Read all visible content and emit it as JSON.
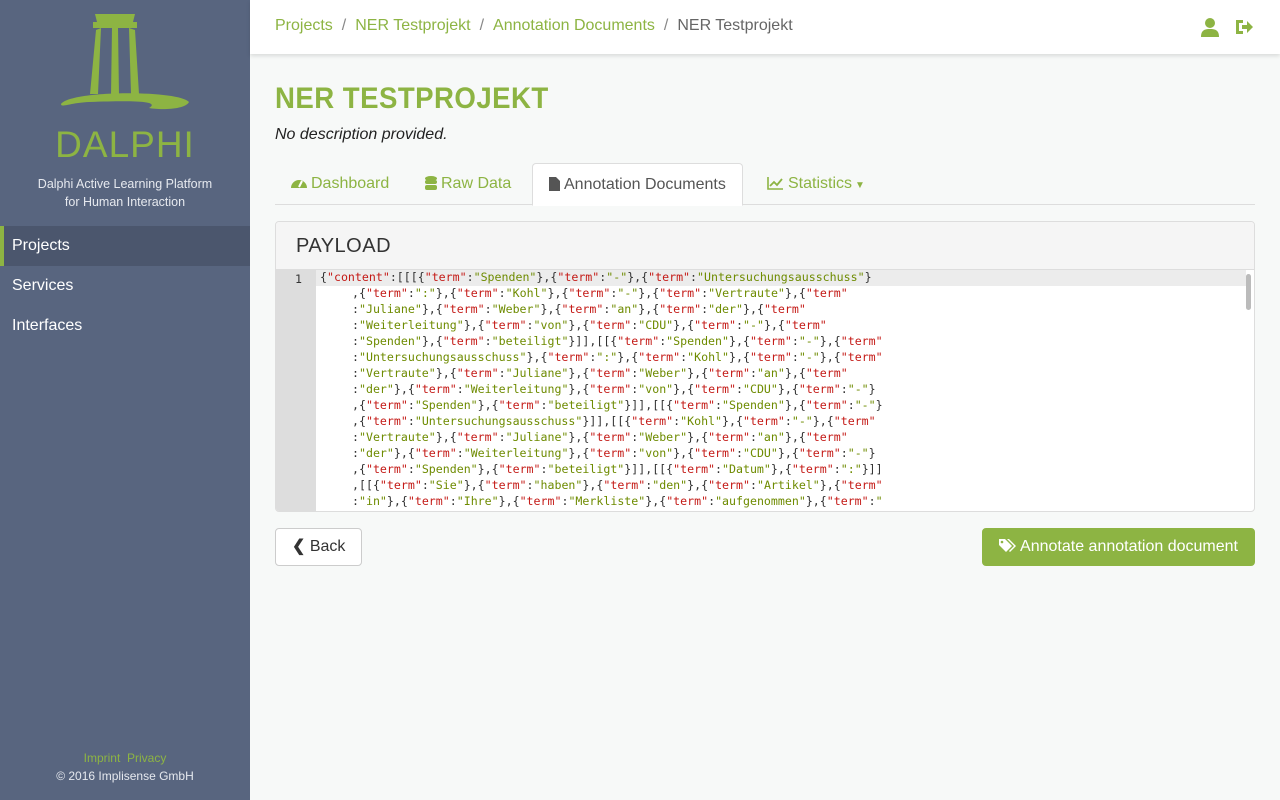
{
  "sidebar": {
    "brand": "DALPHI",
    "tagline_1": "Dalphi Active Learning Platform",
    "tagline_2": "for Human Interaction",
    "items": [
      {
        "label": "Projects",
        "active": true
      },
      {
        "label": "Services"
      },
      {
        "label": "Interfaces"
      }
    ],
    "footer": {
      "imprint": "Imprint",
      "privacy": "Privacy",
      "copyright": "© 2016 Implisense GmbH"
    }
  },
  "breadcrumb": [
    "Projects",
    "NER Testprojekt",
    "Annotation Documents",
    "NER Testprojekt"
  ],
  "header_icons": [
    "user-icon",
    "sign-out-icon"
  ],
  "page": {
    "title": "NER TESTPROJEKT",
    "description": "No description provided."
  },
  "tabs": [
    {
      "label": "Dashboard",
      "icon": "dashboard-icon"
    },
    {
      "label": "Raw Data",
      "icon": "database-icon"
    },
    {
      "label": "Annotation Documents",
      "icon": "file-icon",
      "active": true
    },
    {
      "label": "Statistics",
      "icon": "line-chart-icon",
      "dropdown": true
    }
  ],
  "panel": {
    "title": "PAYLOAD",
    "line_number": "1",
    "code_lines": [
      "{\"content\":[[[{\"term\":\"Spenden\"},{\"term\":\"-\"},{\"term\":\"Untersuchungsausschuss\"}",
      ",{\"term\":\":\"},{\"term\":\"Kohl\"},{\"term\":\"-\"},{\"term\":\"Vertraute\"},{\"term\"",
      ":\"Juliane\"},{\"term\":\"Weber\"},{\"term\":\"an\"},{\"term\":\"der\"},{\"term\"",
      ":\"Weiterleitung\"},{\"term\":\"von\"},{\"term\":\"CDU\"},{\"term\":\"-\"},{\"term\"",
      ":\"Spenden\"},{\"term\":\"beteiligt\"}]],[[{\"term\":\"Spenden\"},{\"term\":\"-\"},{\"term\"",
      ":\"Untersuchungsausschuss\"},{\"term\":\":\"},{\"term\":\"Kohl\"},{\"term\":\"-\"},{\"term\"",
      ":\"Vertraute\"},{\"term\":\"Juliane\"},{\"term\":\"Weber\"},{\"term\":\"an\"},{\"term\"",
      ":\"der\"},{\"term\":\"Weiterleitung\"},{\"term\":\"von\"},{\"term\":\"CDU\"},{\"term\":\"-\"}",
      ",{\"term\":\"Spenden\"},{\"term\":\"beteiligt\"}]],[[{\"term\":\"Spenden\"},{\"term\":\"-\"}",
      ",{\"term\":\"Untersuchungsausschuss\"}]],[[{\"term\":\"Kohl\"},{\"term\":\"-\"},{\"term\"",
      ":\"Vertraute\"},{\"term\":\"Juliane\"},{\"term\":\"Weber\"},{\"term\":\"an\"},{\"term\"",
      ":\"der\"},{\"term\":\"Weiterleitung\"},{\"term\":\"von\"},{\"term\":\"CDU\"},{\"term\":\"-\"}",
      ",{\"term\":\"Spenden\"},{\"term\":\"beteiligt\"}]],[[{\"term\":\"Datum\"},{\"term\":\":\"}]]",
      ",[[{\"term\":\"Sie\"},{\"term\":\"haben\"},{\"term\":\"den\"},{\"term\":\"Artikel\"},{\"term\"",
      ":\"in\"},{\"term\":\"Ihre\"},{\"term\":\"Merkliste\"},{\"term\":\"aufgenommen\"},{\"term\":\""
    ]
  },
  "buttons": {
    "back": "Back",
    "annotate": "Annotate annotation document"
  },
  "colors": {
    "accent": "#8db443",
    "sidebar": "#58657f",
    "key": "#c41a16",
    "string": "#6e8b00"
  }
}
